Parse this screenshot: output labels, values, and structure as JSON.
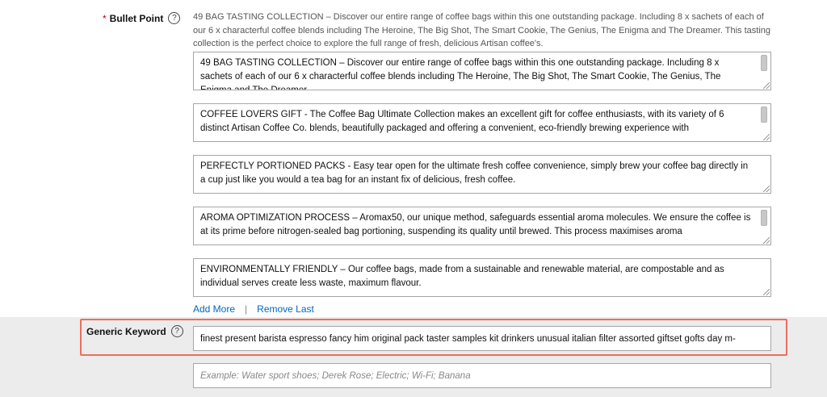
{
  "bullet_point": {
    "label": "Bullet Point",
    "required_mark": "*",
    "help_glyph": "?",
    "hint": "49 BAG TASTING COLLECTION – Discover our entire range of coffee bags within this one outstanding package. Including 8 x sachets of each of our 6 x characterful coffee blends including The Heroine, The Big Shot, The Smart Cookie, The Genius, The Enigma and The Dreamer. This tasting collection is the perfect choice to explore the full range of fresh, delicious Artisan coffee's.",
    "fields": [
      {
        "value": "49 BAG TASTING COLLECTION – Discover our entire range of coffee bags within this one outstanding package. Including 8 x sachets of each of our 6 x characterful coffee blends including The Heroine, The Big Shot, The Smart Cookie, The Genius, The Enigma and The Dreamer."
      },
      {
        "value": "COFFEE LOVERS GIFT - The Coffee Bag Ultimate Collection makes an excellent gift for coffee enthusiasts, with its variety of 6 distinct Artisan Coffee Co. blends, beautifully packaged and offering a convenient, eco-friendly brewing experience with"
      },
      {
        "value": "PERFECTLY PORTIONED PACKS - Easy tear open for the ultimate fresh coffee convenience, simply brew your coffee bag directly in a cup just like you would a tea bag for an instant fix of delicious, fresh coffee."
      },
      {
        "value": "AROMA OPTIMIZATION PROCESS – Aromax50, our unique method, safeguards essential aroma molecules. We ensure the coffee is at its prime before nitrogen-sealed bag portioning, suspending its quality until brewed. This process maximises aroma"
      },
      {
        "value": "ENVIRONMENTALLY FRIENDLY – Our coffee bags, made from a sustainable and renewable material, are compostable and as individual serves create less waste, maximum flavour."
      }
    ],
    "add_more": "Add More",
    "separator": "|",
    "remove_last": "Remove Last"
  },
  "generic_keyword": {
    "label": "Generic Keyword",
    "help_glyph": "?",
    "value": "finest present barista espresso fancy him original pack taster samples kit drinkers unusual italian filter assorted giftset gofts day m-",
    "placeholder": "Example: Water sport shoes; Derek Rose; Electric; Wi-Fi; Banana"
  },
  "colors": {
    "link": "#0066c0",
    "highlight": "#ec6e5e",
    "band": "#ececec"
  }
}
